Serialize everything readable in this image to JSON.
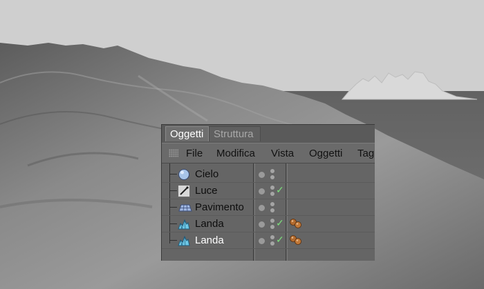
{
  "panel": {
    "tabs": [
      {
        "label": "Oggetti",
        "active": true
      },
      {
        "label": "Struttura",
        "active": false
      }
    ],
    "menu": [
      "File",
      "Modifica",
      "Vista",
      "Oggetti",
      "Tag"
    ],
    "objects": [
      {
        "name": "Cielo",
        "icon": "sky-sphere-icon",
        "enabled": false,
        "tags": false,
        "selected": false
      },
      {
        "name": "Luce",
        "icon": "light-icon",
        "enabled": true,
        "tags": false,
        "selected": false
      },
      {
        "name": "Pavimento",
        "icon": "floor-grid-icon",
        "enabled": false,
        "tags": false,
        "selected": false
      },
      {
        "name": "Landa",
        "icon": "landscape-icon",
        "enabled": true,
        "tags": true,
        "selected": false
      },
      {
        "name": "Landa",
        "icon": "landscape-icon",
        "enabled": true,
        "tags": true,
        "selected": true
      }
    ]
  },
  "colors": {
    "sky": "#cfcfcf",
    "floor": "#6e6e6e",
    "panel_bg": "#656565",
    "check": "#7ce07c",
    "tag_ball": "#b36b2e"
  }
}
